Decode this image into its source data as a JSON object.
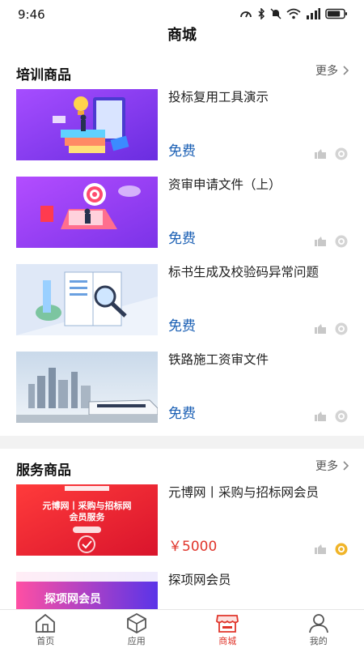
{
  "status_bar": {
    "time": "9:46",
    "battery_level": 0.8
  },
  "header": {
    "title": "商城"
  },
  "sections": [
    {
      "title": "培训商品",
      "more_label": "更多",
      "items": [
        {
          "title": "投标复用工具演示",
          "price": "免费",
          "thumb": "bulb-books-illustration",
          "badge": "gray"
        },
        {
          "title": "资审申请文件（上）",
          "price": "免费",
          "thumb": "target-laptop-illustration",
          "badge": "gray"
        },
        {
          "title": "标书生成及校验码异常问题",
          "price": "免费",
          "thumb": "magnifier-book-illustration",
          "badge": "gray"
        },
        {
          "title": "铁路施工资审文件",
          "price": "免费",
          "thumb": "city-train-photo",
          "badge": "gray"
        }
      ]
    },
    {
      "title": "服务商品",
      "more_label": "更多",
      "items": [
        {
          "title": "元博网丨采购与招标网会员",
          "price": "￥5000",
          "thumb": "red-banner",
          "badge": "gold",
          "banner_text": "元博网丨采购与招标网",
          "banner_sub": "会员服务"
        },
        {
          "title": "探项网会员",
          "price": "",
          "thumb": "purple-banner",
          "badge": "gray",
          "banner_text": "探项网会员"
        }
      ]
    }
  ],
  "tabbar": {
    "tabs": [
      {
        "label": "首页",
        "icon": "home-icon",
        "active": false
      },
      {
        "label": "应用",
        "icon": "cube-icon",
        "active": false
      },
      {
        "label": "商城",
        "icon": "store-icon",
        "active": true
      },
      {
        "label": "我的",
        "icon": "user-icon",
        "active": false
      }
    ]
  },
  "colors": {
    "price_blue": "#1a5fb4",
    "price_red": "#e0352b",
    "active_tab": "#e0352b",
    "gold_badge": "#f0b429"
  }
}
